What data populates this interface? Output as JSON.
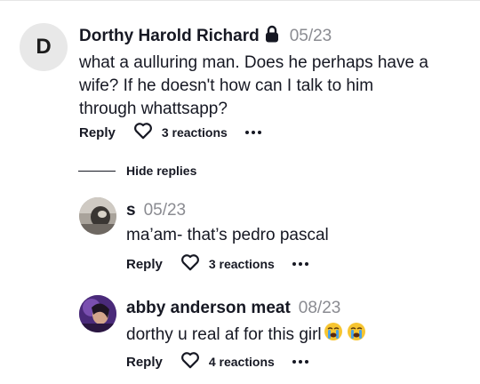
{
  "comment": {
    "avatar_letter": "D",
    "author": "Dorthy Harold Richard",
    "date": "05/23",
    "text_lines": [
      "what a aulluring man. Does he perhaps have a",
      "wife? If he doesn't how can I talk to him",
      "through whattsapp?"
    ],
    "reply_label": "Reply",
    "reactions": "3 reactions"
  },
  "hide_replies_label": "Hide replies",
  "replies": [
    {
      "author": "s",
      "date": "05/23",
      "text": "ma’am- that’s pedro pascal",
      "reply_label": "Reply",
      "reactions": "3 reactions"
    },
    {
      "author": "abby anderson meat",
      "date": "08/23",
      "text": "dorthy u real af for this girl",
      "emojis": [
        "crying-face",
        "crying-face"
      ],
      "reply_label": "Reply",
      "reactions": "4 reactions"
    }
  ],
  "colors": {
    "text": "#161823",
    "muted": "#8a8b91",
    "avatar_bg": "#e8e8e8"
  }
}
